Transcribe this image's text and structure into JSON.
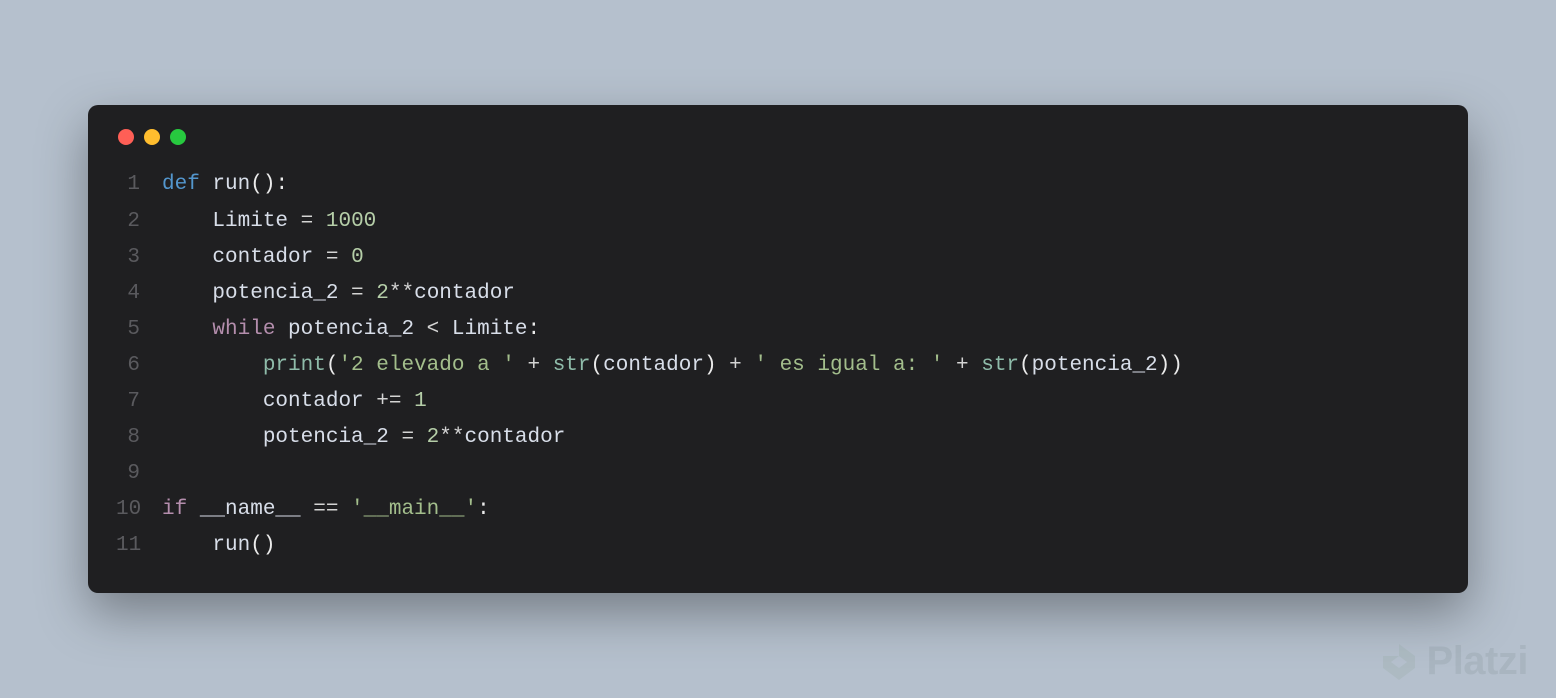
{
  "window": {
    "dots": [
      "red",
      "yellow",
      "green"
    ]
  },
  "code": {
    "lines": [
      {
        "num": "1",
        "tokens": [
          {
            "cls": "tok-keyword",
            "text": "def "
          },
          {
            "cls": "tok-func",
            "text": "run"
          },
          {
            "cls": "tok-white",
            "text": "():"
          }
        ]
      },
      {
        "num": "2",
        "tokens": [
          {
            "cls": "",
            "text": "    "
          },
          {
            "cls": "tok-var",
            "text": "Limite "
          },
          {
            "cls": "tok-operator",
            "text": "= "
          },
          {
            "cls": "tok-number",
            "text": "1000"
          }
        ]
      },
      {
        "num": "3",
        "tokens": [
          {
            "cls": "",
            "text": "    "
          },
          {
            "cls": "tok-var",
            "text": "contador "
          },
          {
            "cls": "tok-operator",
            "text": "= "
          },
          {
            "cls": "tok-number",
            "text": "0"
          }
        ]
      },
      {
        "num": "4",
        "tokens": [
          {
            "cls": "",
            "text": "    "
          },
          {
            "cls": "tok-var",
            "text": "potencia_2 "
          },
          {
            "cls": "tok-operator",
            "text": "= "
          },
          {
            "cls": "tok-number",
            "text": "2"
          },
          {
            "cls": "tok-operator",
            "text": "**"
          },
          {
            "cls": "tok-var",
            "text": "contador"
          }
        ]
      },
      {
        "num": "5",
        "tokens": [
          {
            "cls": "",
            "text": "    "
          },
          {
            "cls": "tok-keyword-soft",
            "text": "while "
          },
          {
            "cls": "tok-var",
            "text": "potencia_2 "
          },
          {
            "cls": "tok-operator",
            "text": "< "
          },
          {
            "cls": "tok-var",
            "text": "Limite"
          },
          {
            "cls": "tok-white",
            "text": ":"
          }
        ]
      },
      {
        "num": "6",
        "tokens": [
          {
            "cls": "",
            "text": "        "
          },
          {
            "cls": "tok-builtin",
            "text": "print"
          },
          {
            "cls": "tok-white",
            "text": "("
          },
          {
            "cls": "tok-string",
            "text": "'2 elevado a '"
          },
          {
            "cls": "tok-operator",
            "text": " + "
          },
          {
            "cls": "tok-builtin",
            "text": "str"
          },
          {
            "cls": "tok-white",
            "text": "("
          },
          {
            "cls": "tok-var",
            "text": "contador"
          },
          {
            "cls": "tok-white",
            "text": ")"
          },
          {
            "cls": "tok-operator",
            "text": " + "
          },
          {
            "cls": "tok-string",
            "text": "' es igual a: '"
          },
          {
            "cls": "tok-operator",
            "text": " + "
          },
          {
            "cls": "tok-builtin",
            "text": "str"
          },
          {
            "cls": "tok-white",
            "text": "("
          },
          {
            "cls": "tok-var",
            "text": "potencia_2"
          },
          {
            "cls": "tok-white",
            "text": "))"
          }
        ]
      },
      {
        "num": "7",
        "tokens": [
          {
            "cls": "",
            "text": "        "
          },
          {
            "cls": "tok-var",
            "text": "contador "
          },
          {
            "cls": "tok-operator",
            "text": "+= "
          },
          {
            "cls": "tok-number",
            "text": "1"
          }
        ]
      },
      {
        "num": "8",
        "tokens": [
          {
            "cls": "",
            "text": "        "
          },
          {
            "cls": "tok-var",
            "text": "potencia_2 "
          },
          {
            "cls": "tok-operator",
            "text": "= "
          },
          {
            "cls": "tok-number",
            "text": "2"
          },
          {
            "cls": "tok-operator",
            "text": "**"
          },
          {
            "cls": "tok-var",
            "text": "contador"
          }
        ]
      },
      {
        "num": "9",
        "tokens": []
      },
      {
        "num": "10",
        "tokens": [
          {
            "cls": "tok-keyword-soft",
            "text": "if "
          },
          {
            "cls": "tok-var",
            "text": "__name__ "
          },
          {
            "cls": "tok-operator",
            "text": "== "
          },
          {
            "cls": "tok-string",
            "text": "'__main__'"
          },
          {
            "cls": "tok-white",
            "text": ":"
          }
        ]
      },
      {
        "num": "11",
        "tokens": [
          {
            "cls": "",
            "text": "    "
          },
          {
            "cls": "tok-func",
            "text": "run"
          },
          {
            "cls": "tok-white",
            "text": "()"
          }
        ]
      }
    ]
  },
  "watermark": {
    "text": "Platzi"
  }
}
